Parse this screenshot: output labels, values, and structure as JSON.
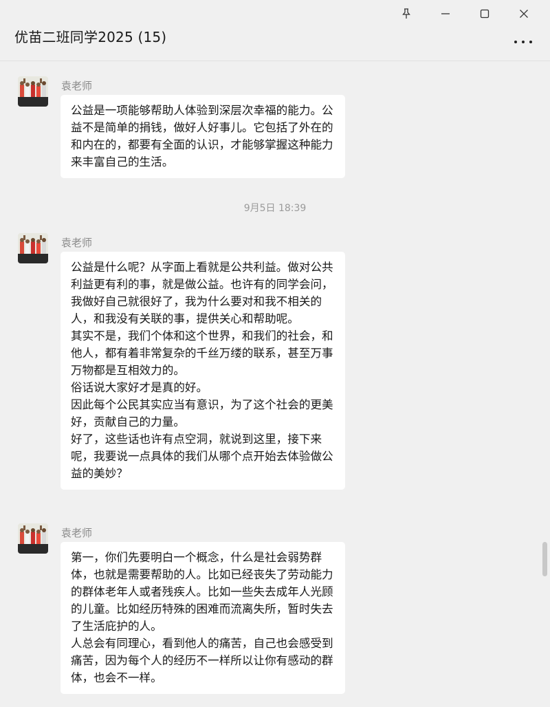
{
  "window": {
    "title": "优苗二班同学2025 (15)"
  },
  "icons": {
    "pin": "pin-icon",
    "minimize": "minimize-icon",
    "maximize": "maximize-icon",
    "close": "close-icon",
    "more": "more-icon"
  },
  "messages": [
    {
      "sender": "袁老师",
      "text": "公益是一项能够帮助人体验到深层次幸福的能力。公益不是简单的捐钱，做好人好事儿。它包括了外在的和内在的，都要有全面的认识，才能够掌握这种能力来丰富自己的生活。"
    },
    {
      "sender": "袁老师",
      "text": "公益是什么呢？从字面上看就是公共利益。做对公共利益更有利的事，就是做公益。也许有的同学会问，我做好自己就很好了，我为什么要对和我不相关的人，和我没有关联的事，提供关心和帮助呢。\n其实不是，我们个体和这个世界，和我们的社会，和他人，都有着非常复杂的千丝万缕的联系，甚至万事万物都是互相效力的。\n俗话说大家好才是真的好。\n因此每个公民其实应当有意识，为了这个社会的更美好，贡献自己的力量。\n好了，这些话也许有点空洞，就说到这里，接下来呢，我要说一点具体的我们从哪个点开始去体验做公益的美妙？"
    },
    {
      "sender": "袁老师",
      "text": "第一，你们先要明白一个概念，什么是社会弱势群体，也就是需要帮助的人。比如已经丧失了劳动能力的群体老年人或者残疾人。比如一些失去成年人光顾的儿童。比如经历特殊的困难而流离失所，暂时失去了生活庇护的人。\n人总会有同理心，看到他人的痛苦，自己也会感受到痛苦，因为每个人的经历不一样所以让你有感动的群体，也会不一样。"
    }
  ],
  "timestamp": "9月5日 18:39",
  "colors": {
    "background": "#f0f0f0",
    "bubble": "#ffffff",
    "sender": "#8a8a8a",
    "timestamp": "#9a9a9a"
  }
}
